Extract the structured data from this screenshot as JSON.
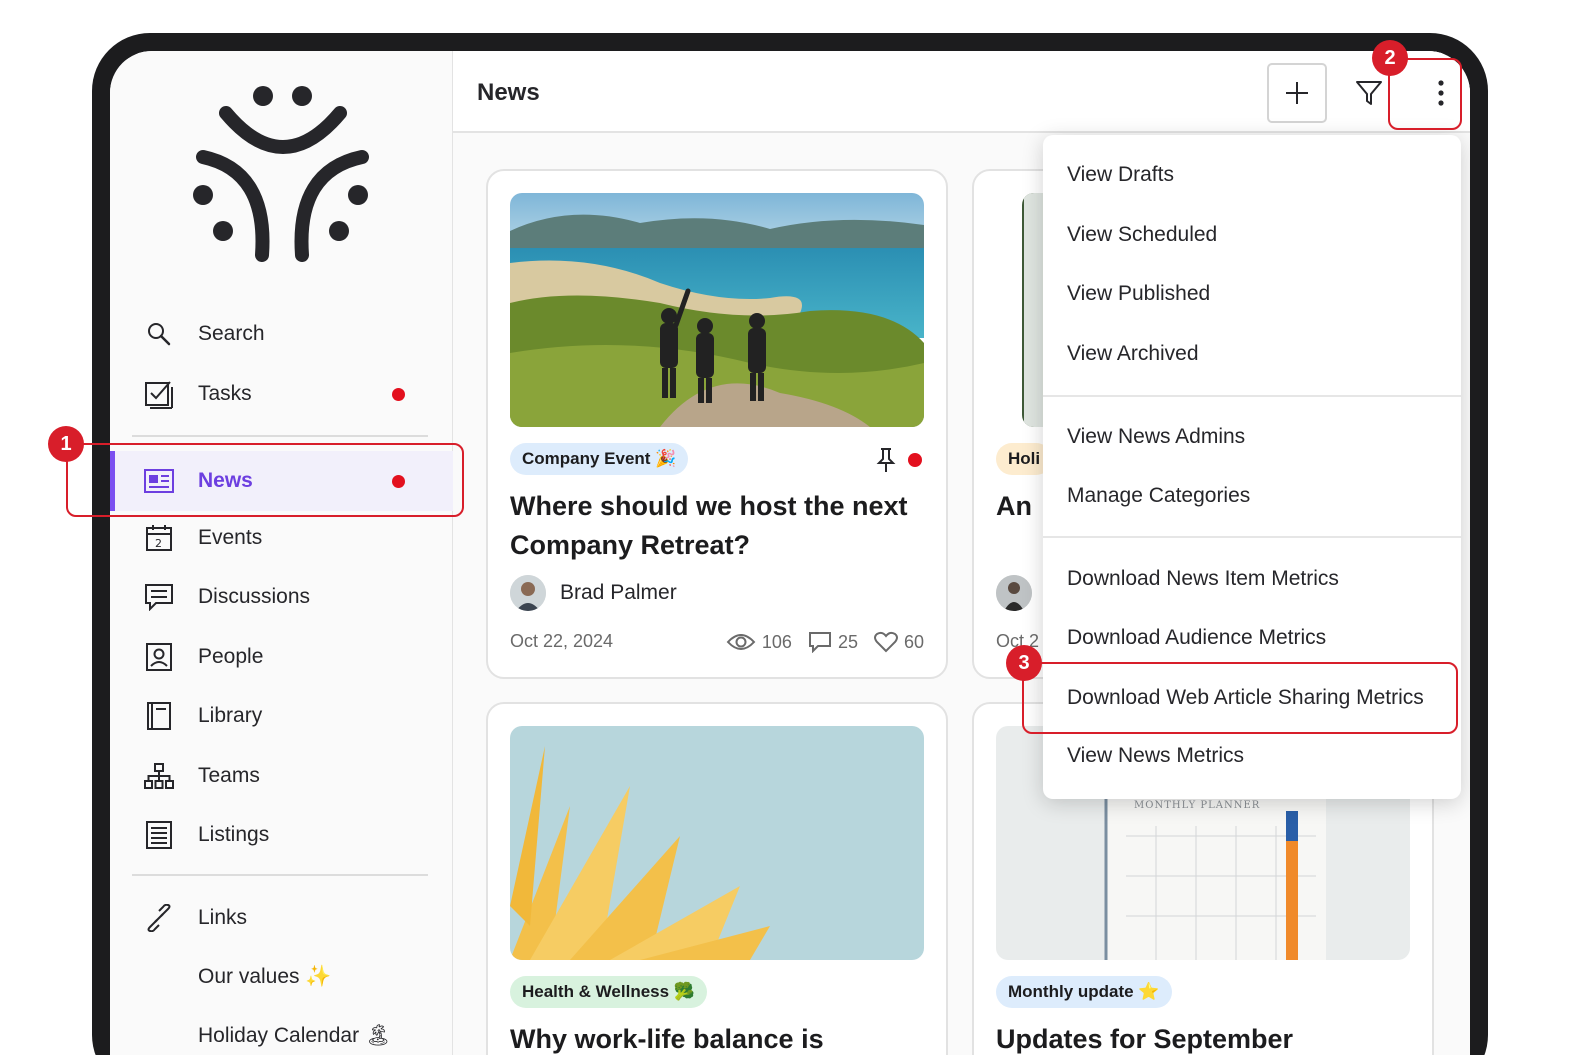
{
  "header": {
    "title": "News"
  },
  "sidebar": {
    "items": [
      {
        "label": "Search",
        "icon": "search-icon",
        "dot": false
      },
      {
        "label": "Tasks",
        "icon": "tasks-icon",
        "dot": true
      },
      {
        "label": "News",
        "icon": "news-icon",
        "dot": true,
        "active": true
      },
      {
        "label": "Events",
        "icon": "calendar-icon",
        "dot": false
      },
      {
        "label": "Discussions",
        "icon": "discussions-icon",
        "dot": false
      },
      {
        "label": "People",
        "icon": "people-icon",
        "dot": false
      },
      {
        "label": "Library",
        "icon": "library-icon",
        "dot": false
      },
      {
        "label": "Teams",
        "icon": "teams-icon",
        "dot": false
      },
      {
        "label": "Listings",
        "icon": "listings-icon",
        "dot": false
      },
      {
        "label": "Links",
        "icon": "link-icon",
        "dot": false
      },
      {
        "label": "Our values ✨",
        "icon": "",
        "dot": false
      },
      {
        "label": "Holiday Calendar 🏝",
        "icon": "",
        "dot": false
      }
    ]
  },
  "cards": [
    {
      "tag": "Company Event 🎉",
      "title": "Where should we host the next Company Retreat?",
      "author": "Brad Palmer",
      "date": "Oct 22, 2024",
      "views": "106",
      "comments": "25",
      "likes": "60"
    },
    {
      "tag": "Holi",
      "title": "An",
      "date": "Oct 2"
    },
    {
      "tag": "Health & Wellness 🥦",
      "title": "Why work-life balance is"
    },
    {
      "tag": "Monthly update ⭐",
      "title": "Updates for September",
      "image_text": "MONTHLY PLANNER"
    }
  ],
  "menu": {
    "items": [
      "View Drafts",
      "View Scheduled",
      "View Published",
      "View Archived",
      "View News Admins",
      "Manage Categories",
      "Download News Item Metrics",
      "Download Audience Metrics",
      "Download Web Article Sharing Metrics",
      "View News Metrics"
    ]
  },
  "annotations": {
    "badge1": "1",
    "badge2": "2",
    "badge3": "3"
  },
  "colors": {
    "accent": "#7b4ff0",
    "highlight": "#d81e2a",
    "notification": "#e3101e"
  }
}
